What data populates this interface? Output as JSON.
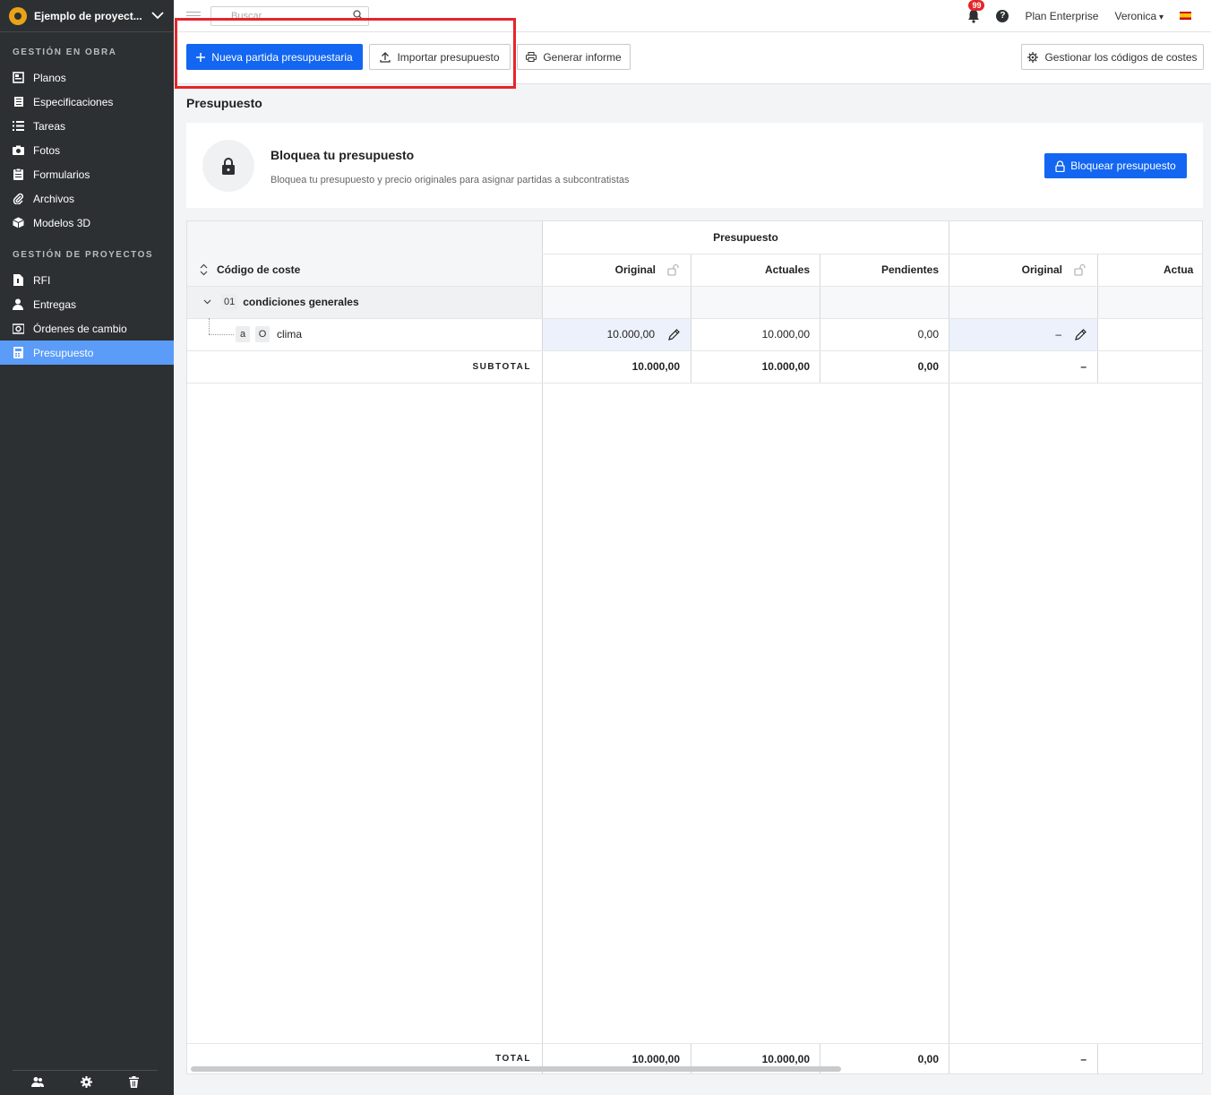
{
  "project": {
    "name": "Ejemplo de proyect..."
  },
  "sidebar": {
    "section1": "GESTIÓN EN OBRA",
    "section2": "GESTIÓN DE PROYECTOS",
    "items": [
      {
        "label": "Planos",
        "icon": "plans-icon"
      },
      {
        "label": "Especificaciones",
        "icon": "specifications-icon"
      },
      {
        "label": "Tareas",
        "icon": "tasks-icon"
      },
      {
        "label": "Fotos",
        "icon": "camera-icon"
      },
      {
        "label": "Formularios",
        "icon": "forms-icon"
      },
      {
        "label": "Archivos",
        "icon": "paperclip-icon"
      },
      {
        "label": "Modelos 3D",
        "icon": "cube-icon"
      },
      {
        "label": "RFI",
        "icon": "rfi-icon"
      },
      {
        "label": "Entregas",
        "icon": "person-icon"
      },
      {
        "label": "Órdenes de cambio",
        "icon": "change-order-icon"
      },
      {
        "label": "Presupuesto",
        "icon": "calculator-icon",
        "active": true
      }
    ]
  },
  "topbar": {
    "search_placeholder": "Buscar",
    "notifications": "99",
    "help": "?",
    "plan": "Plan Enterprise",
    "user": "Veronica"
  },
  "toolbar": {
    "new_item": "Nueva partida presupuestaria",
    "import": "Importar presupuesto",
    "report": "Generar informe",
    "manage_codes": "Gestionar los códigos de costes"
  },
  "page": {
    "title": "Presupuesto"
  },
  "lock_card": {
    "title": "Bloquea tu presupuesto",
    "subtitle": "Bloquea tu presupuesto y precio originales para asignar partidas a subcontratistas",
    "button": "Bloquear presupuesto"
  },
  "table": {
    "group_header": "Presupuesto",
    "cost_code_header": "Código de coste",
    "columns": [
      "Original",
      "Actuales",
      "Pendientes",
      "Original",
      "Actua"
    ],
    "group_row": {
      "code": "01",
      "name": "condiciones generales"
    },
    "item_row": {
      "tag1": "a",
      "tag2": "O",
      "name": "clima",
      "original": "10.000,00",
      "actuales": "10.000,00",
      "pendientes": "0,00",
      "original2": "–"
    },
    "subtotal": {
      "label": "SUBTOTAL",
      "original": "10.000,00",
      "actuales": "10.000,00",
      "pendientes": "0,00",
      "original2": "–"
    },
    "total": {
      "label": "TOTAL",
      "original": "10.000,00",
      "actuales": "10.000,00",
      "pendientes": "0,00",
      "original2": "–"
    }
  },
  "colors": {
    "sidebar": "#2d3032",
    "accent": "#1266f1",
    "active_nav": "#5a9cf8",
    "badge": "#e5252a"
  }
}
